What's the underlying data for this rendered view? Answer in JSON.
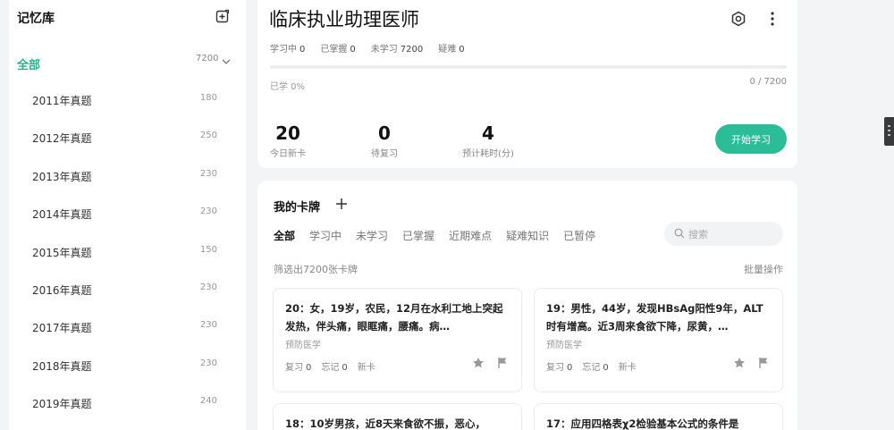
{
  "sidebar": {
    "title": "记忆库",
    "all": {
      "label": "全部",
      "count": "7200"
    },
    "items": [
      {
        "label": "2011年真题",
        "count": "180"
      },
      {
        "label": "2012年真题",
        "count": "250"
      },
      {
        "label": "2013年真题",
        "count": "230"
      },
      {
        "label": "2014年真题",
        "count": "230"
      },
      {
        "label": "2015年真题",
        "count": "150"
      },
      {
        "label": "2016年真题",
        "count": "230"
      },
      {
        "label": "2017年真题",
        "count": "230"
      },
      {
        "label": "2018年真题",
        "count": "230"
      },
      {
        "label": "2019年真题",
        "count": "240"
      }
    ]
  },
  "overview": {
    "title": "临床执业助理医师",
    "stats": [
      {
        "label": "学习中",
        "value": "0"
      },
      {
        "label": "已掌握",
        "value": "0"
      },
      {
        "label": "未学习",
        "value": "7200"
      },
      {
        "label": "疑难",
        "value": "0"
      }
    ],
    "progress_fraction": 0,
    "learned_label": "已学 0%",
    "progress_text": "0 / 7200",
    "metrics": [
      {
        "num": "20",
        "caption": "今日新卡"
      },
      {
        "num": "0",
        "caption": "待复习"
      },
      {
        "num": "4",
        "caption": "预计耗时(分)"
      }
    ],
    "start_button": "开始学习"
  },
  "deck": {
    "title": "我的卡牌",
    "tabs": [
      "全部",
      "学习中",
      "未学习",
      "已掌握",
      "近期难点",
      "疑难知识",
      "已暂停"
    ],
    "search_placeholder": "搜索",
    "filter_info": "筛选出7200张卡牌",
    "bulk_action": "批量操作",
    "cards": [
      {
        "question": "20：女，19岁，农民，12月在水利工地上突起发热，伴头痛，眼眶痛，腰痛。病…",
        "subject": "预防医学",
        "review_label": "复习",
        "review": "0",
        "forget_label": "忘记",
        "forget": "0",
        "status": "新卡"
      },
      {
        "question": "19：男性，44岁，发现HBsAg阳性9年，ALT时有增高。近3周来食欲下降，尿黄，…",
        "subject": "预防医学",
        "review_label": "复习",
        "review": "0",
        "forget_label": "忘记",
        "forget": "0",
        "status": "新卡"
      },
      {
        "question": "18：10岁男孩，近8天来食欲不振，恶心，",
        "subject": "",
        "review_label": "",
        "review": "",
        "forget_label": "",
        "forget": "",
        "status": ""
      },
      {
        "question": "17：应用四格表χ2检验基本公式的条件是",
        "subject": "",
        "review_label": "",
        "review": "",
        "forget_label": "",
        "forget": "",
        "status": ""
      }
    ]
  },
  "colors": {
    "accent": "#2ab08e",
    "button": "#2bbd98"
  },
  "icons": {
    "sidebar_add": "add-box-icon",
    "all_chevron": "chevron-down-icon",
    "settings": "settings-icon",
    "more": "more-vertical-icon",
    "deck_add": "plus-icon",
    "search": "search-icon",
    "star": "star-icon",
    "flag": "flag-icon"
  }
}
